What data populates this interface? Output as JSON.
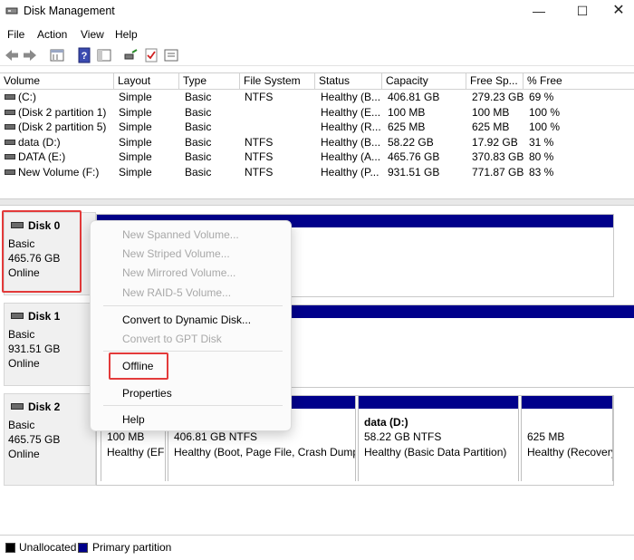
{
  "window": {
    "title": "Disk Management"
  },
  "menu": [
    "File",
    "Action",
    "View",
    "Help"
  ],
  "toolbar": {
    "icons": [
      "back-arrow-icon",
      "forward-arrow-icon",
      "properties-icon",
      "help-icon",
      "console-tree-icon",
      "rescan-icon",
      "check-icon",
      "list-icon"
    ]
  },
  "volume_list": {
    "columns": [
      "Volume",
      "Layout",
      "Type",
      "File System",
      "Status",
      "Capacity",
      "Free Sp...",
      "% Free"
    ],
    "rows": [
      [
        "(C:)",
        "Simple",
        "Basic",
        "NTFS",
        "Healthy (B...",
        "406.81 GB",
        "279.23 GB",
        "69 %"
      ],
      [
        "(Disk 2 partition 1)",
        "Simple",
        "Basic",
        "",
        "Healthy (E...",
        "100 MB",
        "100 MB",
        "100 %"
      ],
      [
        "(Disk 2 partition 5)",
        "Simple",
        "Basic",
        "",
        "Healthy (R...",
        "625 MB",
        "625 MB",
        "100 %"
      ],
      [
        "data (D:)",
        "Simple",
        "Basic",
        "NTFS",
        "Healthy (B...",
        "58.22 GB",
        "17.92 GB",
        "31 %"
      ],
      [
        "DATA (E:)",
        "Simple",
        "Basic",
        "NTFS",
        "Healthy (A...",
        "465.76 GB",
        "370.83 GB",
        "80 %"
      ],
      [
        "New Volume (F:)",
        "Simple",
        "Basic",
        "NTFS",
        "Healthy (P...",
        "931.51 GB",
        "771.87 GB",
        "83 %"
      ]
    ]
  },
  "disks": [
    {
      "name": "Disk 0",
      "type": "Basic",
      "size": "465.76 GB",
      "status": "Online"
    },
    {
      "name": "Disk 1",
      "type": "Basic",
      "size": "931.51 GB",
      "status": "Online"
    },
    {
      "name": "Disk 2",
      "type": "Basic",
      "size": "465.75 GB",
      "status": "Online"
    }
  ],
  "disk2_partitions": [
    {
      "name": "",
      "line1": "100 MB",
      "line2": "Healthy (EF"
    },
    {
      "name": "",
      "line1": "406.81 GB NTFS",
      "line2": "Healthy (Boot, Page File, Crash Dump,"
    },
    {
      "name": "data  (D:)",
      "line1": "58.22 GB NTFS",
      "line2": "Healthy (Basic Data Partition)"
    },
    {
      "name": "",
      "line1": "625 MB",
      "line2": "Healthy (Recovery"
    }
  ],
  "context_menu": {
    "items": [
      {
        "label": "New Spanned Volume...",
        "enabled": false
      },
      {
        "label": "New Striped Volume...",
        "enabled": false
      },
      {
        "label": "New Mirrored Volume...",
        "enabled": false
      },
      {
        "label": "New RAID-5 Volume...",
        "enabled": false
      },
      {
        "label": "Convert to Dynamic Disk...",
        "enabled": true
      },
      {
        "label": "Convert to GPT Disk",
        "enabled": false
      },
      {
        "label": "Offline",
        "enabled": true
      },
      {
        "label": "Properties",
        "enabled": true
      },
      {
        "label": "Help",
        "enabled": true
      }
    ]
  },
  "legend": {
    "items": [
      {
        "label": "Unallocated",
        "color": "#000000"
      },
      {
        "label": "Primary partition",
        "color": "#00008b"
      }
    ]
  },
  "colors": {
    "primary_partition": "#00008b",
    "highlight_box": "#e33a3a"
  }
}
